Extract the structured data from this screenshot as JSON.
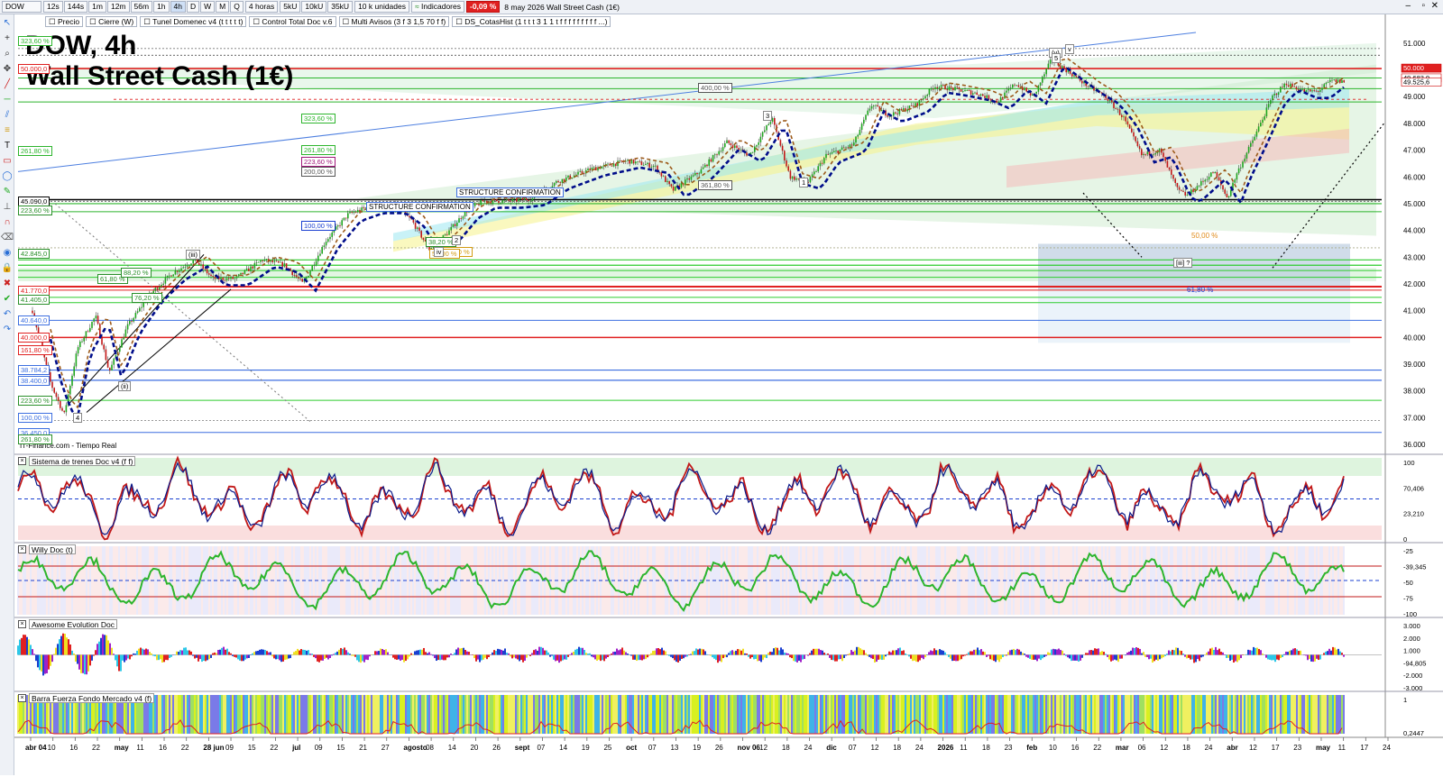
{
  "toolbar": {
    "symbol": "DOW",
    "timeframes": [
      "12s",
      "144s",
      "1m",
      "12m",
      "56m",
      "1h",
      "4h",
      "D",
      "W",
      "M",
      "Q"
    ],
    "active_timeframe": "4h",
    "period_select": "4 horas",
    "volume_buttons": [
      "5kU",
      "10kU",
      "35kU"
    ],
    "units_select": "10 k unidades",
    "indicators_label": "Indicadores",
    "change_badge": "-0,09 %",
    "date_title": "8 may 2026 Wall Street Cash (1€)"
  },
  "studies_bar": {
    "items": [
      "Precio",
      "Cierre (W)",
      "Tunel Domenec v4 (t t t t t)",
      "Control Total Doc v.6",
      "Multi Avisos (3 f 3 1,5 70 f f)",
      "DS_CotasHist (1 t t t 3 1 1 t f f f f f f f f f ...)"
    ]
  },
  "main_chart": {
    "title_line1": "DOW, 4h",
    "title_line2": "Wall Street Cash (1€)",
    "source": "IT-Finance.com - Tiempo Real",
    "y_axis_labels": [
      "51.000",
      "49.000",
      "48.000",
      "47.000",
      "46.000",
      "45.000",
      "44.000",
      "43.000",
      "42.000",
      "41.000",
      "40.000",
      "39.000",
      "38.000",
      "37.000",
      "36.000"
    ],
    "price_badges": [
      "50.000",
      "49.683,9",
      "49.525,6"
    ],
    "level_tags": [
      "400,00 %",
      "361,80 %",
      "323,60 %",
      "261,80 %",
      "223,60 %",
      "200,00 %",
      "161,80 %",
      "100,00 %",
      "50,00 %",
      "38,20 %",
      "61,80 %",
      "76,20 %",
      "88,20 %"
    ],
    "left_levels": [
      "323,60 %",
      "50.000,0",
      "261,80 %",
      "45.090,0",
      "223,60 %",
      "42.845,0",
      "41.770,0",
      "41.405,0",
      "40.640,0",
      "40.000,0",
      "161,80 %",
      "38.784,2",
      "38.400,0",
      "223,60 %",
      "100,00 %",
      "36.450,0",
      "261,80 %"
    ],
    "annotations": [
      "STRUCTURE CONFIRMATION",
      "STRUCTURE CONFIRMATION",
      "[iii] ?",
      "(v)",
      "v",
      "5",
      "3",
      "4",
      "(iii)",
      "(ii)",
      "iv",
      "2",
      "1"
    ],
    "zone_labels": [
      "50,00 %",
      "61,80 %"
    ]
  },
  "panes": [
    {
      "name": "Sistema de trenes Doc v4 (f f)",
      "axis": [
        "100",
        "70,406",
        "23,210",
        "0"
      ]
    },
    {
      "name": "Willy Doc (t)",
      "axis": [
        "-25",
        "-39,345",
        "-50",
        "-75",
        "-100"
      ]
    },
    {
      "name": "Awesome Evolution Doc",
      "axis": [
        "3.000",
        "2.000",
        "1.000",
        "-94,805",
        "-2.000",
        "-3.000"
      ]
    },
    {
      "name": "Barra Fuerza Fondo Mercado v4 (f)",
      "axis": [
        "1",
        "0,2447"
      ]
    }
  ],
  "x_axis": {
    "labels": [
      "abr 04",
      "10",
      "16",
      "22",
      "may",
      "11",
      "16",
      "22",
      "28 jun",
      "09",
      "15",
      "22",
      "jul",
      "09",
      "15",
      "21",
      "27",
      "agosto",
      "08",
      "14",
      "20",
      "26",
      "sept",
      "07",
      "14",
      "19",
      "25",
      "oct",
      "07",
      "13",
      "19",
      "26",
      "nov 06",
      "12",
      "18",
      "24",
      "dic",
      "07",
      "12",
      "18",
      "24",
      "2026",
      "11",
      "18",
      "23",
      "feb",
      "10",
      "16",
      "22",
      "mar",
      "06",
      "12",
      "18",
      "24",
      "abr",
      "12",
      "17",
      "23",
      "may",
      "11",
      "17",
      "24"
    ]
  },
  "colors": {
    "accent_red": "#e02020",
    "bull_green": "#2db52d",
    "bear_red": "#c21818",
    "level_green": "#2ecc2e",
    "level_blue": "#3d6fe0",
    "tunnel_blue": "#000d8a"
  }
}
